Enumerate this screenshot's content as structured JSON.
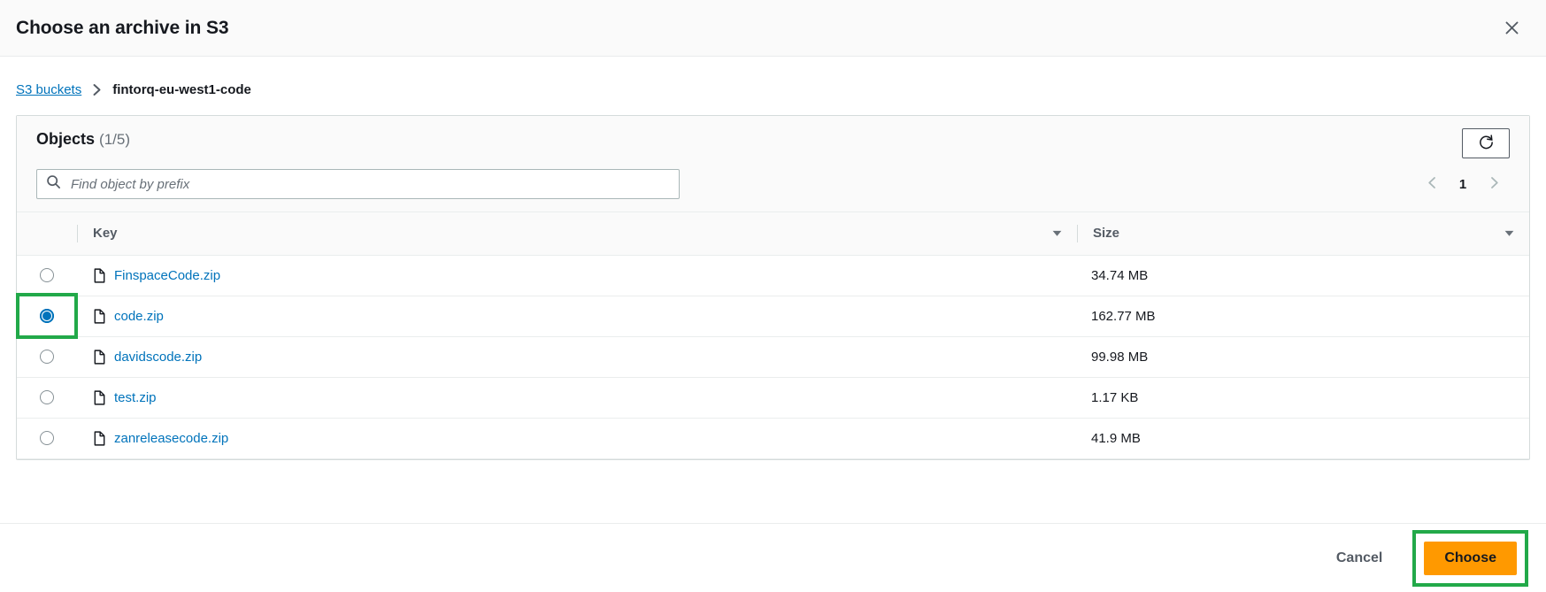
{
  "header": {
    "title": "Choose an archive in S3",
    "close_icon": "close-icon"
  },
  "breadcrumb": {
    "root_label": "S3 buckets",
    "separator": "chevron-right-icon",
    "current_label": "fintorq-eu-west1-code"
  },
  "panel": {
    "title": "Objects",
    "count": "(1/5)",
    "refresh_icon": "refresh-icon"
  },
  "search": {
    "placeholder": "Find object by prefix",
    "value": "",
    "icon": "search-icon"
  },
  "pagination": {
    "prev_icon": "chevron-left-icon",
    "next_icon": "chevron-right-icon",
    "current_page": "1"
  },
  "table": {
    "columns": [
      "",
      "Key",
      "Size"
    ],
    "sort_icon": "caret-down-icon",
    "file_icon": "file-icon",
    "rows": [
      {
        "key": "FinspaceCode.zip",
        "size": "34.74 MB",
        "selected": false
      },
      {
        "key": "code.zip",
        "size": "162.77 MB",
        "selected": true
      },
      {
        "key": "davidscode.zip",
        "size": "99.98 MB",
        "selected": false
      },
      {
        "key": "test.zip",
        "size": "1.17 KB",
        "selected": false
      },
      {
        "key": "zanreleasecode.zip",
        "size": "41.9 MB",
        "selected": false
      }
    ]
  },
  "footer": {
    "cancel_label": "Cancel",
    "choose_label": "Choose"
  },
  "colors": {
    "link": "#0073bb",
    "primary_button": "#ff9900",
    "annotation": "#22a949",
    "selected_row_bg": "#f1faff"
  }
}
